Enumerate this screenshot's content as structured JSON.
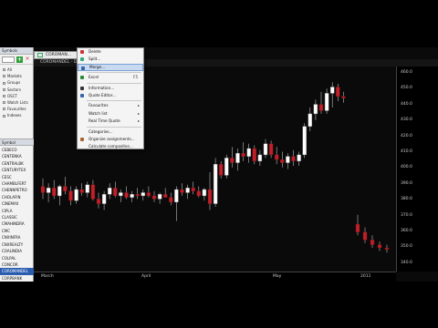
{
  "left_panel": {
    "title": "Symbols",
    "tree": [
      "All",
      "Markets",
      "Groups",
      "Sectors",
      "OSCT",
      "Watch Lists",
      "Favourites",
      "Indexes"
    ],
    "symbol_header": "Symbol",
    "symbols": [
      "CEBECO",
      "CENTENKA",
      "CENTRALBK",
      "CENTURYTEX",
      "CESC",
      "CHAMBLFERT",
      "CHENNPETRO",
      "CHOLAFIN",
      "CINEMAX",
      "CIPLA",
      "CLASSIC",
      "CMAHINDRA",
      "CMC",
      "CNXINFRA",
      "CNXREALTY",
      "COALINDIA",
      "COLPAL",
      "CONCOR",
      "COROMANDEL",
      "CORPBANK"
    ],
    "selected_symbol": "COROMANDEL"
  },
  "chart": {
    "tab_label": "COROMAN...",
    "strip_label": "COROMANDEL - Dai",
    "y_labels": [
      "460.0",
      "450.0",
      "440.0",
      "430.0",
      "420.0",
      "410.0",
      "400.0",
      "390.0",
      "380.0",
      "370.0",
      "360.0",
      "350.0",
      "340.0"
    ],
    "x_labels": [
      "March",
      "April",
      "May",
      "2011"
    ]
  },
  "menu": {
    "items": [
      {
        "label": "Delete",
        "key": "",
        "arrow": false,
        "icon": "delete-icon",
        "color": "#c33"
      },
      {
        "label": "Split...",
        "key": "",
        "arrow": false,
        "icon": "split-icon",
        "color": "#3a7"
      },
      {
        "label": "Merge...",
        "key": "",
        "arrow": false,
        "icon": "merge-icon",
        "color": "#36a",
        "highlight": true
      },
      {
        "sep": true
      },
      {
        "label": "Excel",
        "key": "F5",
        "arrow": false,
        "icon": "excel-icon",
        "color": "#2a8a3a"
      },
      {
        "sep": true
      },
      {
        "label": "Information...",
        "key": "",
        "arrow": false,
        "icon": "info-icon",
        "color": "#333"
      },
      {
        "label": "Quote Editor...",
        "key": "",
        "arrow": false,
        "icon": "quote-editor-icon",
        "color": "#36a"
      },
      {
        "sep": true
      },
      {
        "label": "Favourites",
        "key": "",
        "arrow": true,
        "icon": "",
        "color": ""
      },
      {
        "label": "Watch list",
        "key": "",
        "arrow": true,
        "icon": "",
        "color": ""
      },
      {
        "label": "Real Time Quote",
        "key": "",
        "arrow": true,
        "icon": "",
        "color": ""
      },
      {
        "sep": true
      },
      {
        "label": "Categories...",
        "key": "",
        "arrow": false,
        "icon": "",
        "color": ""
      },
      {
        "label": "Organize assignments...",
        "key": "",
        "arrow": false,
        "icon": "organize-icon",
        "color": "#a63"
      },
      {
        "label": "Calculate composites...",
        "key": "",
        "arrow": false,
        "icon": "",
        "color": ""
      }
    ]
  },
  "chart_data": {
    "type": "candlestick",
    "ylim": [
      336,
      466
    ],
    "candles": [
      {
        "o": 390,
        "h": 395,
        "l": 382,
        "c": 386
      },
      {
        "o": 386,
        "h": 392,
        "l": 380,
        "c": 389
      },
      {
        "o": 389,
        "h": 394,
        "l": 382,
        "c": 384
      },
      {
        "o": 384,
        "h": 391,
        "l": 378,
        "c": 390
      },
      {
        "o": 390,
        "h": 396,
        "l": 385,
        "c": 387
      },
      {
        "o": 387,
        "h": 390,
        "l": 378,
        "c": 381
      },
      {
        "o": 381,
        "h": 390,
        "l": 379,
        "c": 388
      },
      {
        "o": 388,
        "h": 392,
        "l": 384,
        "c": 386
      },
      {
        "o": 386,
        "h": 393,
        "l": 383,
        "c": 391
      },
      {
        "o": 391,
        "h": 394,
        "l": 381,
        "c": 382
      },
      {
        "o": 382,
        "h": 386,
        "l": 376,
        "c": 379
      },
      {
        "o": 379,
        "h": 387,
        "l": 375,
        "c": 385
      },
      {
        "o": 385,
        "h": 392,
        "l": 382,
        "c": 389
      },
      {
        "o": 389,
        "h": 393,
        "l": 383,
        "c": 384
      },
      {
        "o": 384,
        "h": 388,
        "l": 380,
        "c": 386
      },
      {
        "o": 386,
        "h": 390,
        "l": 382,
        "c": 383
      },
      {
        "o": 383,
        "h": 387,
        "l": 380,
        "c": 385
      },
      {
        "o": 385,
        "h": 389,
        "l": 382,
        "c": 384
      },
      {
        "o": 384,
        "h": 388,
        "l": 381,
        "c": 386
      },
      {
        "o": 386,
        "h": 390,
        "l": 383,
        "c": 384
      },
      {
        "o": 384,
        "h": 387,
        "l": 380,
        "c": 382
      },
      {
        "o": 382,
        "h": 386,
        "l": 379,
        "c": 385
      },
      {
        "o": 385,
        "h": 389,
        "l": 383,
        "c": 383
      },
      {
        "o": 383,
        "h": 386,
        "l": 378,
        "c": 380
      },
      {
        "o": 380,
        "h": 390,
        "l": 368,
        "c": 388
      },
      {
        "o": 388,
        "h": 392,
        "l": 384,
        "c": 386
      },
      {
        "o": 386,
        "h": 391,
        "l": 382,
        "c": 389
      },
      {
        "o": 389,
        "h": 393,
        "l": 385,
        "c": 387
      },
      {
        "o": 387,
        "h": 390,
        "l": 383,
        "c": 384
      },
      {
        "o": 384,
        "h": 389,
        "l": 381,
        "c": 388
      },
      {
        "o": 388,
        "h": 399,
        "l": 375,
        "c": 379
      },
      {
        "o": 379,
        "h": 408,
        "l": 377,
        "c": 404
      },
      {
        "o": 404,
        "h": 406,
        "l": 395,
        "c": 397
      },
      {
        "o": 397,
        "h": 410,
        "l": 395,
        "c": 408
      },
      {
        "o": 408,
        "h": 415,
        "l": 402,
        "c": 405
      },
      {
        "o": 405,
        "h": 414,
        "l": 400,
        "c": 411
      },
      {
        "o": 411,
        "h": 418,
        "l": 406,
        "c": 409
      },
      {
        "o": 409,
        "h": 417,
        "l": 405,
        "c": 414
      },
      {
        "o": 414,
        "h": 416,
        "l": 404,
        "c": 406
      },
      {
        "o": 406,
        "h": 413,
        "l": 403,
        "c": 410
      },
      {
        "o": 410,
        "h": 420,
        "l": 408,
        "c": 417
      },
      {
        "o": 417,
        "h": 419,
        "l": 408,
        "c": 410
      },
      {
        "o": 410,
        "h": 415,
        "l": 404,
        "c": 407
      },
      {
        "o": 407,
        "h": 412,
        "l": 402,
        "c": 405
      },
      {
        "o": 405,
        "h": 411,
        "l": 401,
        "c": 409
      },
      {
        "o": 409,
        "h": 413,
        "l": 403,
        "c": 406
      },
      {
        "o": 406,
        "h": 412,
        "l": 403,
        "c": 410
      },
      {
        "o": 410,
        "h": 430,
        "l": 408,
        "c": 428
      },
      {
        "o": 428,
        "h": 440,
        "l": 425,
        "c": 436
      },
      {
        "o": 436,
        "h": 445,
        "l": 432,
        "c": 442
      },
      {
        "o": 442,
        "h": 450,
        "l": 436,
        "c": 438
      },
      {
        "o": 438,
        "h": 452,
        "l": 436,
        "c": 449
      },
      {
        "o": 449,
        "h": 456,
        "l": 440,
        "c": 453
      },
      {
        "o": 453,
        "h": 455,
        "l": 444,
        "c": 447
      },
      {
        "o": 447,
        "h": 450,
        "l": 443,
        "c": 446
      },
      {
        "o": 366,
        "h": 372,
        "l": 359,
        "c": 361
      },
      {
        "o": 361,
        "h": 364,
        "l": 354,
        "c": 356
      },
      {
        "o": 356,
        "h": 359,
        "l": 351,
        "c": 353
      },
      {
        "o": 353,
        "h": 355,
        "l": 349,
        "c": 351
      },
      {
        "o": 351,
        "h": 353,
        "l": 348,
        "c": 350
      }
    ]
  }
}
